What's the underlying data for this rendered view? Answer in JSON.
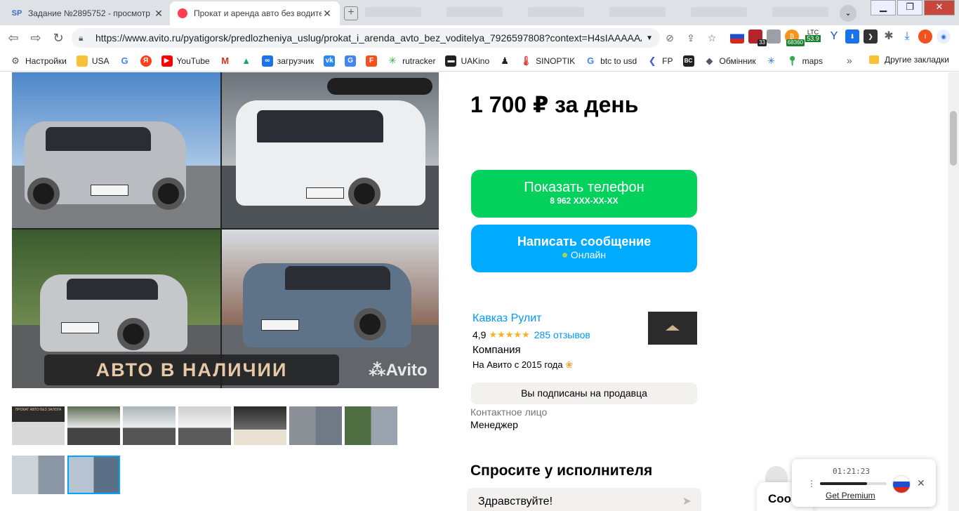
{
  "browser": {
    "tabs": [
      {
        "favicon": "SP",
        "title": "Задание №2895752 - просмотр з"
      },
      {
        "favicon": "avito-icon",
        "title": "Прокат и аренда авто без водите"
      }
    ],
    "url": "https://www.avito.ru/pyatigorsk/predlozheniya_uslug/prokat_i_arenda_avto_bez_voditelya_7926597808?context=H4sIAAAAAA...",
    "extensions": {
      "badge_count": "33",
      "btc_price": "68360",
      "ltc_label": "LTC",
      "ltc_price": "53.9",
      "profile_letter": "I"
    },
    "bookmarks": [
      {
        "icon": "gear-icon",
        "label": "Настройки"
      },
      {
        "icon": "folder-icon",
        "label": "USA"
      },
      {
        "icon": "google-icon",
        "label": ""
      },
      {
        "icon": "yandex-icon",
        "label": ""
      },
      {
        "icon": "youtube-icon",
        "label": "YouTube"
      },
      {
        "icon": "gmail-icon",
        "label": ""
      },
      {
        "icon": "drive-icon",
        "label": ""
      },
      {
        "icon": "infinity-icon",
        "label": "загрузчик"
      },
      {
        "icon": "vk-icon",
        "label": ""
      },
      {
        "icon": "translate-icon",
        "label": ""
      },
      {
        "icon": "f-icon",
        "label": ""
      },
      {
        "icon": "rutracker-icon",
        "label": "rutracker"
      },
      {
        "icon": "uakino-icon",
        "label": "UAKino"
      },
      {
        "icon": "figure-icon",
        "label": ""
      },
      {
        "icon": "thermometer-icon",
        "label": "SINOPTIK"
      },
      {
        "icon": "google-icon",
        "label": "btc to usd"
      },
      {
        "icon": "fp-icon",
        "label": "FP"
      },
      {
        "icon": "bc-icon",
        "label": ""
      },
      {
        "icon": "exchange-icon",
        "label": "Обмінник"
      },
      {
        "icon": "star-spark-icon",
        "label": ""
      },
      {
        "icon": "maps-pin-icon",
        "label": "maps"
      }
    ],
    "bookmarks_more": "»",
    "other_bookmarks": "Другие закладки"
  },
  "listing": {
    "photo_banner": "АВТО В НАЛИЧИИ",
    "photo_watermark": "Avito",
    "price": "1 700 ₽ за день",
    "show_phone": {
      "label": "Показать телефон",
      "phone": "8 962 XXX-XX-XX"
    },
    "write_message": {
      "label": "Написать сообщение",
      "status": "Онлайн"
    },
    "seller": {
      "name": "Кавказ Рулит",
      "rating": "4,9",
      "stars": "★★★★★",
      "reviews": "285 отзывов",
      "type": "Компания",
      "since": "На Авито с 2015 года"
    },
    "subscribed": "Вы подписаны на продавца",
    "contact_label": "Контактное лицо",
    "contact_role": "Менеджер",
    "ask_title": "Спросите у исполнителя",
    "ask_input": "Здравствуйте!",
    "thumbnails": [
      {
        "caption": "ПРОКАТ АВТО БЕЗ ЗАЛОГА"
      },
      {
        "caption": ""
      },
      {
        "caption": ""
      },
      {
        "caption": ""
      },
      {
        "caption": ""
      },
      {
        "caption": ""
      },
      {
        "caption": ""
      },
      {
        "caption": ""
      },
      {
        "caption": ""
      }
    ],
    "selected_thumbnail": 9
  },
  "widgets": {
    "chat_label": "Соо",
    "player_time": "01:21:23",
    "player_progress": 0.7,
    "player_premium": "Get Premium"
  },
  "colors": {
    "phone_button": "#02d15c",
    "message_button": "#00aaff",
    "link": "#0099f7",
    "star": "#ffb021"
  }
}
